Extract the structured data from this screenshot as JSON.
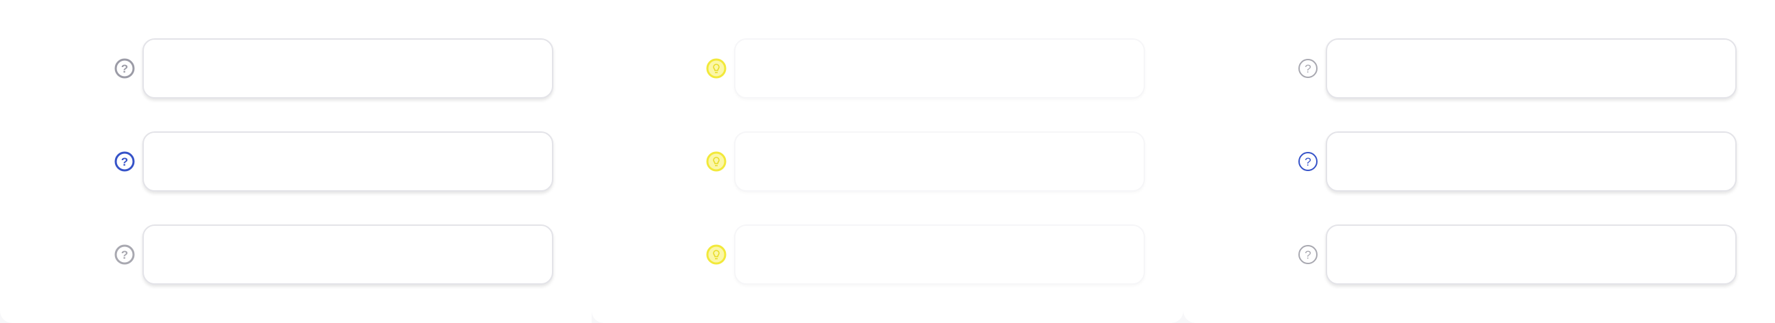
{
  "colors": {
    "icon_gray": "#9b9ba6",
    "icon_blue": "#3552c8",
    "icon_yellow": "#f2e93a",
    "icon_light_gray": "#a8a8b0",
    "border": "#e3e3e8",
    "background": "#ffffff"
  },
  "columns": [
    {
      "fields": [
        {
          "icon": "question-circle-icon",
          "icon_color": "#9b9ba6",
          "value": "",
          "placeholder": ""
        },
        {
          "icon": "question-circle-icon",
          "icon_color": "#3552c8",
          "value": "",
          "placeholder": ""
        },
        {
          "icon": "question-circle-icon",
          "icon_color": "#a8a8b0",
          "value": "",
          "placeholder": ""
        }
      ]
    },
    {
      "fields": [
        {
          "icon": "lightbulb-icon",
          "icon_color": "#f2e93a",
          "value": "",
          "placeholder": ""
        },
        {
          "icon": "lightbulb-icon",
          "icon_color": "#f2e93a",
          "value": "",
          "placeholder": ""
        },
        {
          "icon": "lightbulb-icon",
          "icon_color": "#f2e93a",
          "value": "",
          "placeholder": ""
        }
      ]
    },
    {
      "fields": [
        {
          "icon": "question-circle-icon",
          "icon_color": "#a8a8b0",
          "value": "",
          "placeholder": ""
        },
        {
          "icon": "question-circle-icon",
          "icon_color": "#3552c8",
          "value": "",
          "placeholder": ""
        },
        {
          "icon": "question-circle-icon",
          "icon_color": "#a8a8b0",
          "value": "",
          "placeholder": ""
        }
      ]
    }
  ]
}
